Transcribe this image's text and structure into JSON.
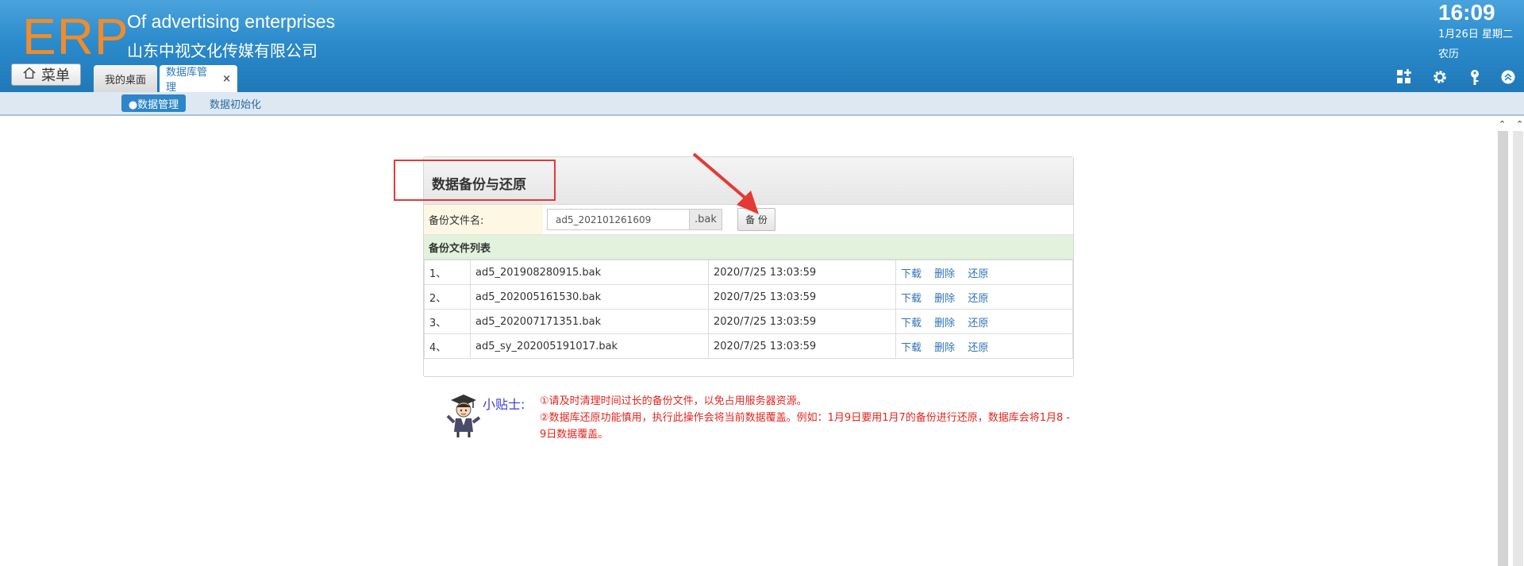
{
  "header": {
    "logo": "ERP",
    "company_en": "Of advertising enterprises",
    "company_cn": "山东中视文化传媒有限公司",
    "time": "16:09",
    "date": "1月26日 星期二",
    "lunar": "农历",
    "menu_label": "菜单",
    "tabs": [
      {
        "label": "我的桌面"
      },
      {
        "label": "数据库管理",
        "close": "×"
      }
    ],
    "tools": [
      "apps-icon",
      "gear-icon",
      "key-icon",
      "collapse-up-icon"
    ]
  },
  "subnav": {
    "items": [
      {
        "label": "●数据管理",
        "active": true
      },
      {
        "label": "数据初始化"
      }
    ]
  },
  "panel": {
    "title": "数据备份与还原",
    "form": {
      "label": "备份文件名:",
      "value": "ad5_202101261609",
      "suffix": ".bak",
      "button": "备 份"
    },
    "list_title": "备份文件列表",
    "rows": [
      {
        "index": "1、",
        "file": "ad5_201908280915.bak",
        "time": "2020/7/25 13:03:59"
      },
      {
        "index": "2、",
        "file": "ad5_202005161530.bak",
        "time": "2020/7/25 13:03:59"
      },
      {
        "index": "3、",
        "file": "ad5_202007171351.bak",
        "time": "2020/7/25 13:03:59"
      },
      {
        "index": "4、",
        "file": "ad5_sy_202005191017.bak",
        "time": "2020/7/25 13:03:59"
      }
    ],
    "actions": {
      "download": "下载",
      "delete": "删除",
      "restore": "还原"
    }
  },
  "tips": {
    "label": "小贴士:",
    "line1": "①请及时清理时间过长的备份文件，以免占用服务器资源。",
    "line2": "②数据库还原功能慎用，执行此操作会将当前数据覆盖。例如：1月9日要用1月7的备份进行还原，数据库会将1月8 - 9日数据覆盖。"
  },
  "colors": {
    "header_top": "#4aa3dc",
    "header_bottom": "#1f78b8",
    "logo": "#f08c2c",
    "accent": "#2c86c8",
    "link": "#2f73b6",
    "tip_text": "#e4241d",
    "annotation": "#e53935"
  }
}
